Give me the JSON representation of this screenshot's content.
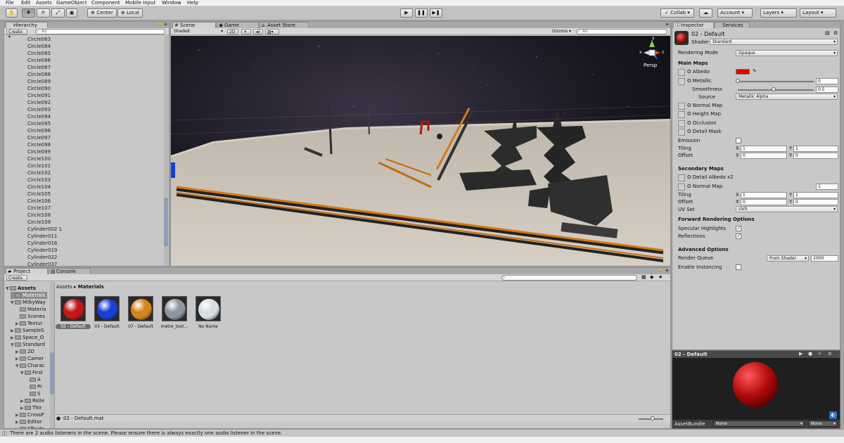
{
  "menu": [
    "File",
    "Edit",
    "Assets",
    "GameObject",
    "Component",
    "Mobile Input",
    "Window",
    "Help"
  ],
  "toolbar": {
    "tools": [
      "hand-tool",
      "move-tool",
      "rotate-tool",
      "scale-tool",
      "rect-tool"
    ],
    "pivot": "Center",
    "space": "Local",
    "collab": "Collab",
    "account": "Account",
    "layers": "Layers",
    "layout": "Layout"
  },
  "hierarchy": {
    "tab": "Hierarchy",
    "create": "Create",
    "search_placeholder": "All",
    "items": [
      "Circle083",
      "Circle084",
      "Circle085",
      "Circle086",
      "Circle087",
      "Circle088",
      "Circle089",
      "Circle090",
      "Circle091",
      "Circle092",
      "Circle093",
      "Circle094",
      "Circle095",
      "Circle096",
      "Circle097",
      "Circle098",
      "Circle099",
      "Circle100",
      "Circle101",
      "Circle102",
      "Circle103",
      "Circle104",
      "Circle105",
      "Circle106",
      "Circle107",
      "Circle108",
      "Circle109",
      "Cylinder002 1",
      "Cylinder011",
      "Cylinder016",
      "Cylinder019",
      "Cylinder022",
      "Cylinder037"
    ]
  },
  "scene": {
    "tabs": [
      "Scene",
      "Game",
      "Asset Store"
    ],
    "shading": "Shaded",
    "mode2d": "2D",
    "gizmos": "Gizmos",
    "search_placeholder": "All",
    "persp": "Persp",
    "gizmo_axes": {
      "y": "y",
      "x": "x",
      "z": "z"
    }
  },
  "project": {
    "tabs": [
      "Project",
      "Console"
    ],
    "create": "Create",
    "breadcrumb_root": "Assets",
    "breadcrumb_sep": "▸",
    "breadcrumb_current": "Materials",
    "tree": [
      {
        "label": "Assets",
        "indent": 0,
        "open": true,
        "bold": true
      },
      {
        "label": "Materials",
        "indent": 1,
        "open": false,
        "selected": true
      },
      {
        "label": "MilkyWay",
        "indent": 1,
        "open": true
      },
      {
        "label": "Materia",
        "indent": 2,
        "open": false
      },
      {
        "label": "Scenes",
        "indent": 2,
        "open": false
      },
      {
        "label": "Textur",
        "indent": 2,
        "open": false,
        "arrow": true
      },
      {
        "label": "SampleS",
        "indent": 1,
        "arrow": true
      },
      {
        "label": "Space_O",
        "indent": 1,
        "arrow": true
      },
      {
        "label": "Standard",
        "indent": 1,
        "open": true
      },
      {
        "label": "2D",
        "indent": 2,
        "arrow": true
      },
      {
        "label": "Camer",
        "indent": 2,
        "arrow": true
      },
      {
        "label": "Charac",
        "indent": 2,
        "open": true
      },
      {
        "label": "First",
        "indent": 3,
        "open": true
      },
      {
        "label": "A",
        "indent": 4
      },
      {
        "label": "Pr",
        "indent": 4
      },
      {
        "label": "S",
        "indent": 4
      },
      {
        "label": "Rolle",
        "indent": 3,
        "arrow": true
      },
      {
        "label": "Thir",
        "indent": 3,
        "arrow": true
      },
      {
        "label": "CrossP",
        "indent": 2,
        "arrow": true
      },
      {
        "label": "Editor",
        "indent": 2,
        "arrow": true
      },
      {
        "label": "Effects",
        "indent": 2,
        "arrow": true
      }
    ],
    "assets": [
      {
        "label": "02 - Default",
        "color": "#c01818",
        "selected": true
      },
      {
        "label": "03 - Default",
        "color": "#1a3fd6",
        "selected": false
      },
      {
        "label": "07 - Default",
        "color": "#d4861c",
        "selected": false
      },
      {
        "label": "metre_text...",
        "color": "#8d97a3",
        "selected": false
      },
      {
        "label": "No Name",
        "color": "#d8dde2",
        "selected": false
      }
    ],
    "footer_file": "02 - Default.mat"
  },
  "inspector": {
    "tabs": [
      "Inspector",
      "Services"
    ],
    "material_name": "02 - Default",
    "shader_label": "Shader",
    "shader_value": "Standard",
    "rendering_mode_label": "Rendering Mode",
    "rendering_mode_value": "Opaque",
    "main_maps": "Main Maps",
    "albedo": "Albedo",
    "albedo_color": "#e80000",
    "metallic": "Metallic",
    "metallic_value": "0",
    "metallic_level": 0,
    "smoothness": "Smoothness",
    "smoothness_value": "0.5",
    "smoothness_level": 0.5,
    "source": "Source",
    "source_value": "Metallic Alpha",
    "normal_map": "Normal Map",
    "height_map": "Height Map",
    "occlusion": "Occlusion",
    "detail_mask": "Detail Mask",
    "emission": "Emission",
    "tiling": "Tiling",
    "offset": "Offset",
    "x_label": "X",
    "y_label": "Y",
    "tiling_x": "1",
    "tiling_y": "1",
    "offset_x": "0",
    "offset_y": "0",
    "secondary_maps": "Secondary Maps",
    "detail_albedo": "Detail Albedo x2",
    "normal_map2": "Normal Map",
    "normal_map2_value": "1",
    "tiling2_x": "1",
    "tiling2_y": "1",
    "offset2_x": "0",
    "offset2_y": "0",
    "uv_set": "UV Set",
    "uv_set_value": "UV0",
    "forward_opts": "Forward Rendering Options",
    "specular": "Specular Highlights",
    "reflections": "Reflections",
    "advanced": "Advanced Options",
    "render_queue": "Render Queue",
    "render_queue_mode": "From Shader",
    "render_queue_value": "2000",
    "instancing": "Enable Instancing",
    "preview_title": "02 - Default",
    "assetbundle_label": "AssetBundle",
    "assetbundle_value": "None",
    "assetbundle_variant": "None"
  },
  "status": "There are 2 audio listeners in the scene. Please ensure there is always exactly one audio listener in the scene."
}
